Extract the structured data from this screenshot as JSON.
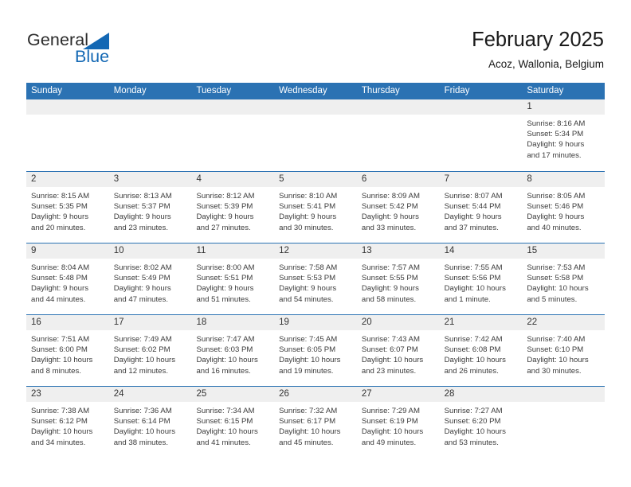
{
  "brand": {
    "word_one": "General",
    "word_two": "Blue",
    "accent_color": "#1368b4",
    "triangle_icon": "triangle-icon"
  },
  "header": {
    "title": "February 2025",
    "subtitle": "Acoz, Wallonia, Belgium"
  },
  "calendar": {
    "header_bg": "#2b72b3",
    "daynum_bg": "#efefef",
    "weekdays": [
      "Sunday",
      "Monday",
      "Tuesday",
      "Wednesday",
      "Thursday",
      "Friday",
      "Saturday"
    ],
    "weeks": [
      [
        {
          "day": "",
          "lines": []
        },
        {
          "day": "",
          "lines": []
        },
        {
          "day": "",
          "lines": []
        },
        {
          "day": "",
          "lines": []
        },
        {
          "day": "",
          "lines": []
        },
        {
          "day": "",
          "lines": []
        },
        {
          "day": "1",
          "lines": [
            "Sunrise: 8:16 AM",
            "Sunset: 5:34 PM",
            "Daylight: 9 hours",
            "and 17 minutes."
          ]
        }
      ],
      [
        {
          "day": "2",
          "lines": [
            "Sunrise: 8:15 AM",
            "Sunset: 5:35 PM",
            "Daylight: 9 hours",
            "and 20 minutes."
          ]
        },
        {
          "day": "3",
          "lines": [
            "Sunrise: 8:13 AM",
            "Sunset: 5:37 PM",
            "Daylight: 9 hours",
            "and 23 minutes."
          ]
        },
        {
          "day": "4",
          "lines": [
            "Sunrise: 8:12 AM",
            "Sunset: 5:39 PM",
            "Daylight: 9 hours",
            "and 27 minutes."
          ]
        },
        {
          "day": "5",
          "lines": [
            "Sunrise: 8:10 AM",
            "Sunset: 5:41 PM",
            "Daylight: 9 hours",
            "and 30 minutes."
          ]
        },
        {
          "day": "6",
          "lines": [
            "Sunrise: 8:09 AM",
            "Sunset: 5:42 PM",
            "Daylight: 9 hours",
            "and 33 minutes."
          ]
        },
        {
          "day": "7",
          "lines": [
            "Sunrise: 8:07 AM",
            "Sunset: 5:44 PM",
            "Daylight: 9 hours",
            "and 37 minutes."
          ]
        },
        {
          "day": "8",
          "lines": [
            "Sunrise: 8:05 AM",
            "Sunset: 5:46 PM",
            "Daylight: 9 hours",
            "and 40 minutes."
          ]
        }
      ],
      [
        {
          "day": "9",
          "lines": [
            "Sunrise: 8:04 AM",
            "Sunset: 5:48 PM",
            "Daylight: 9 hours",
            "and 44 minutes."
          ]
        },
        {
          "day": "10",
          "lines": [
            "Sunrise: 8:02 AM",
            "Sunset: 5:49 PM",
            "Daylight: 9 hours",
            "and 47 minutes."
          ]
        },
        {
          "day": "11",
          "lines": [
            "Sunrise: 8:00 AM",
            "Sunset: 5:51 PM",
            "Daylight: 9 hours",
            "and 51 minutes."
          ]
        },
        {
          "day": "12",
          "lines": [
            "Sunrise: 7:58 AM",
            "Sunset: 5:53 PM",
            "Daylight: 9 hours",
            "and 54 minutes."
          ]
        },
        {
          "day": "13",
          "lines": [
            "Sunrise: 7:57 AM",
            "Sunset: 5:55 PM",
            "Daylight: 9 hours",
            "and 58 minutes."
          ]
        },
        {
          "day": "14",
          "lines": [
            "Sunrise: 7:55 AM",
            "Sunset: 5:56 PM",
            "Daylight: 10 hours",
            "and 1 minute."
          ]
        },
        {
          "day": "15",
          "lines": [
            "Sunrise: 7:53 AM",
            "Sunset: 5:58 PM",
            "Daylight: 10 hours",
            "and 5 minutes."
          ]
        }
      ],
      [
        {
          "day": "16",
          "lines": [
            "Sunrise: 7:51 AM",
            "Sunset: 6:00 PM",
            "Daylight: 10 hours",
            "and 8 minutes."
          ]
        },
        {
          "day": "17",
          "lines": [
            "Sunrise: 7:49 AM",
            "Sunset: 6:02 PM",
            "Daylight: 10 hours",
            "and 12 minutes."
          ]
        },
        {
          "day": "18",
          "lines": [
            "Sunrise: 7:47 AM",
            "Sunset: 6:03 PM",
            "Daylight: 10 hours",
            "and 16 minutes."
          ]
        },
        {
          "day": "19",
          "lines": [
            "Sunrise: 7:45 AM",
            "Sunset: 6:05 PM",
            "Daylight: 10 hours",
            "and 19 minutes."
          ]
        },
        {
          "day": "20",
          "lines": [
            "Sunrise: 7:43 AM",
            "Sunset: 6:07 PM",
            "Daylight: 10 hours",
            "and 23 minutes."
          ]
        },
        {
          "day": "21",
          "lines": [
            "Sunrise: 7:42 AM",
            "Sunset: 6:08 PM",
            "Daylight: 10 hours",
            "and 26 minutes."
          ]
        },
        {
          "day": "22",
          "lines": [
            "Sunrise: 7:40 AM",
            "Sunset: 6:10 PM",
            "Daylight: 10 hours",
            "and 30 minutes."
          ]
        }
      ],
      [
        {
          "day": "23",
          "lines": [
            "Sunrise: 7:38 AM",
            "Sunset: 6:12 PM",
            "Daylight: 10 hours",
            "and 34 minutes."
          ]
        },
        {
          "day": "24",
          "lines": [
            "Sunrise: 7:36 AM",
            "Sunset: 6:14 PM",
            "Daylight: 10 hours",
            "and 38 minutes."
          ]
        },
        {
          "day": "25",
          "lines": [
            "Sunrise: 7:34 AM",
            "Sunset: 6:15 PM",
            "Daylight: 10 hours",
            "and 41 minutes."
          ]
        },
        {
          "day": "26",
          "lines": [
            "Sunrise: 7:32 AM",
            "Sunset: 6:17 PM",
            "Daylight: 10 hours",
            "and 45 minutes."
          ]
        },
        {
          "day": "27",
          "lines": [
            "Sunrise: 7:29 AM",
            "Sunset: 6:19 PM",
            "Daylight: 10 hours",
            "and 49 minutes."
          ]
        },
        {
          "day": "28",
          "lines": [
            "Sunrise: 7:27 AM",
            "Sunset: 6:20 PM",
            "Daylight: 10 hours",
            "and 53 minutes."
          ]
        },
        {
          "day": "",
          "lines": []
        }
      ]
    ]
  }
}
